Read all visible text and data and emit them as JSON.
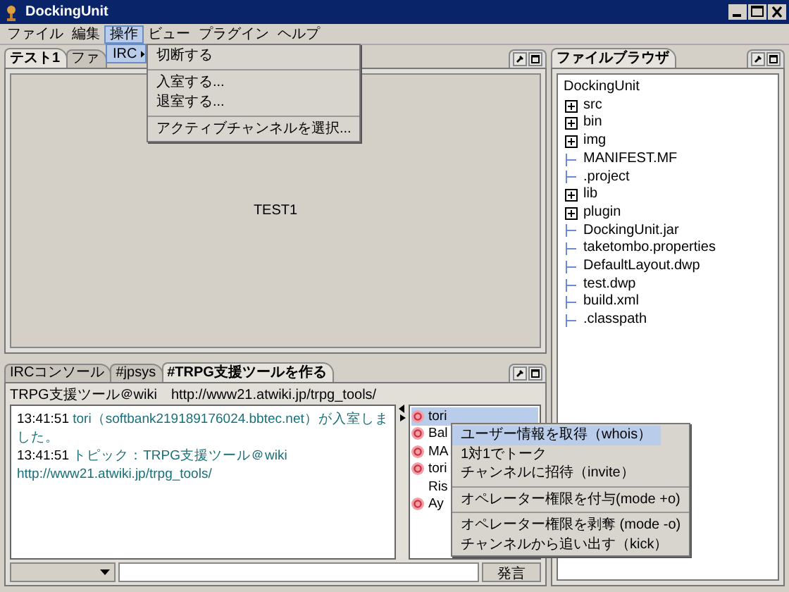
{
  "window": {
    "title": "DockingUnit"
  },
  "menubar": [
    {
      "label": "ファイル",
      "selected": false
    },
    {
      "label": "編集",
      "selected": false
    },
    {
      "label": "操作",
      "selected": true
    },
    {
      "label": "ビュー",
      "selected": false
    },
    {
      "label": "プラグイン",
      "selected": false
    },
    {
      "label": "ヘルプ",
      "selected": false
    }
  ],
  "open_menu": {
    "items": [
      {
        "label": "IRC",
        "selected": true
      }
    ],
    "submenu": [
      {
        "kind": "item",
        "label": "切断する"
      },
      {
        "kind": "separator"
      },
      {
        "kind": "item",
        "label": "入室する..."
      },
      {
        "kind": "item",
        "label": "退室する..."
      },
      {
        "kind": "separator"
      },
      {
        "kind": "item",
        "label": "アクティブチャンネルを選択..."
      }
    ]
  },
  "top_dock": {
    "tabs": [
      {
        "label": "テスト1",
        "selected": true
      },
      {
        "label": "ファ",
        "selected": false
      }
    ],
    "content": "TEST1"
  },
  "bottom_dock": {
    "tabs": [
      {
        "label": "IRCコンソール",
        "selected": false
      },
      {
        "label": "#jpsys",
        "selected": false
      },
      {
        "label": "#TRPG支援ツールを作る",
        "selected": true
      }
    ],
    "topic": "TRPG支援ツール＠wiki　http://www21.atwiki.jp/trpg_tools/",
    "messages": [
      {
        "time": "13:41:51",
        "text": "tori（softbank219189176024.bbtec.net）が入室しました。"
      },
      {
        "time": "13:41:51",
        "text": "トピック：TRPG支援ツール＠wiki　http://www21.atwiki.jp/trpg_tools/"
      }
    ],
    "users": [
      {
        "name": "tori",
        "operator": true,
        "selected": true
      },
      {
        "name": "Bal",
        "operator": true,
        "selected": false
      },
      {
        "name": "MA",
        "operator": true,
        "selected": false
      },
      {
        "name": "tori",
        "operator": true,
        "selected": false
      },
      {
        "name": "Ris",
        "operator": false,
        "selected": false
      },
      {
        "name": "Ay",
        "operator": true,
        "selected": false
      }
    ],
    "send_button": "発言"
  },
  "context_menu": [
    {
      "kind": "item",
      "label": "ユーザー情報を取得（whois）",
      "selected": true
    },
    {
      "kind": "item",
      "label": "1対1でトーク",
      "selected": false
    },
    {
      "kind": "item",
      "label": "チャンネルに招待（invite）",
      "selected": false
    },
    {
      "kind": "separator"
    },
    {
      "kind": "item",
      "label": "オペレーター権限を付与(mode +o)",
      "selected": false
    },
    {
      "kind": "separator"
    },
    {
      "kind": "item",
      "label": "オペレーター権限を剥奪 (mode -o)",
      "selected": false
    },
    {
      "kind": "item",
      "label": "チャンネルから追い出す（kick）",
      "selected": false
    }
  ],
  "file_browser": {
    "tab": {
      "label": "ファイルブラウザ",
      "selected": true
    },
    "tree": {
      "label": "DockingUnit",
      "children": [
        {
          "label": "src",
          "kind": "folder"
        },
        {
          "label": "bin",
          "kind": "folder"
        },
        {
          "label": "img",
          "kind": "folder"
        },
        {
          "label": "MANIFEST.MF",
          "kind": "file"
        },
        {
          "label": ".project",
          "kind": "file"
        },
        {
          "label": "lib",
          "kind": "folder"
        },
        {
          "label": "plugin",
          "kind": "folder"
        },
        {
          "label": "DockingUnit.jar",
          "kind": "file"
        },
        {
          "label": "taketombo.properties",
          "kind": "file"
        },
        {
          "label": "DefaultLayout.dwp",
          "kind": "file"
        },
        {
          "label": "test.dwp",
          "kind": "file"
        },
        {
          "label": "build.xml",
          "kind": "file"
        },
        {
          "label": ".classpath",
          "kind": "file"
        }
      ]
    }
  }
}
